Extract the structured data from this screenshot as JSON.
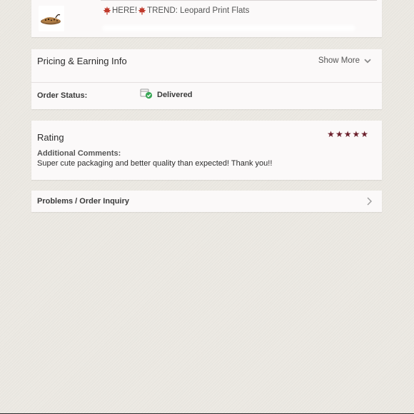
{
  "item": {
    "leaf_left": "🍁",
    "here_text": "HERE!",
    "leaf_right": "🍁",
    "title_text": " TREND: Leopard Print Flats"
  },
  "pricing": {
    "title": "Pricing & Earning Info",
    "show_more_label": "Show More"
  },
  "order_status": {
    "label": "Order Status:",
    "value": "Delivered"
  },
  "rating": {
    "title": "Rating",
    "stars": 5,
    "max_stars": 5,
    "comments_label": "Additional Comments:",
    "comments_text": "Super cute packaging and better quality than expected! Thank you!!"
  },
  "problems": {
    "label": "Problems / Order Inquiry"
  },
  "icons": {
    "thumbnail": "leopard-flat-shoe",
    "show_more": "chevron-down-icon",
    "status": "delivered-package-check-icon",
    "star": "star-icon",
    "problems": "chevron-right-icon"
  },
  "colors": {
    "star": "#6b1f2b",
    "check_green": "#3aa757",
    "leaf": "#c0392b",
    "background": "#ece9e3",
    "card": "#fbf9f9"
  }
}
